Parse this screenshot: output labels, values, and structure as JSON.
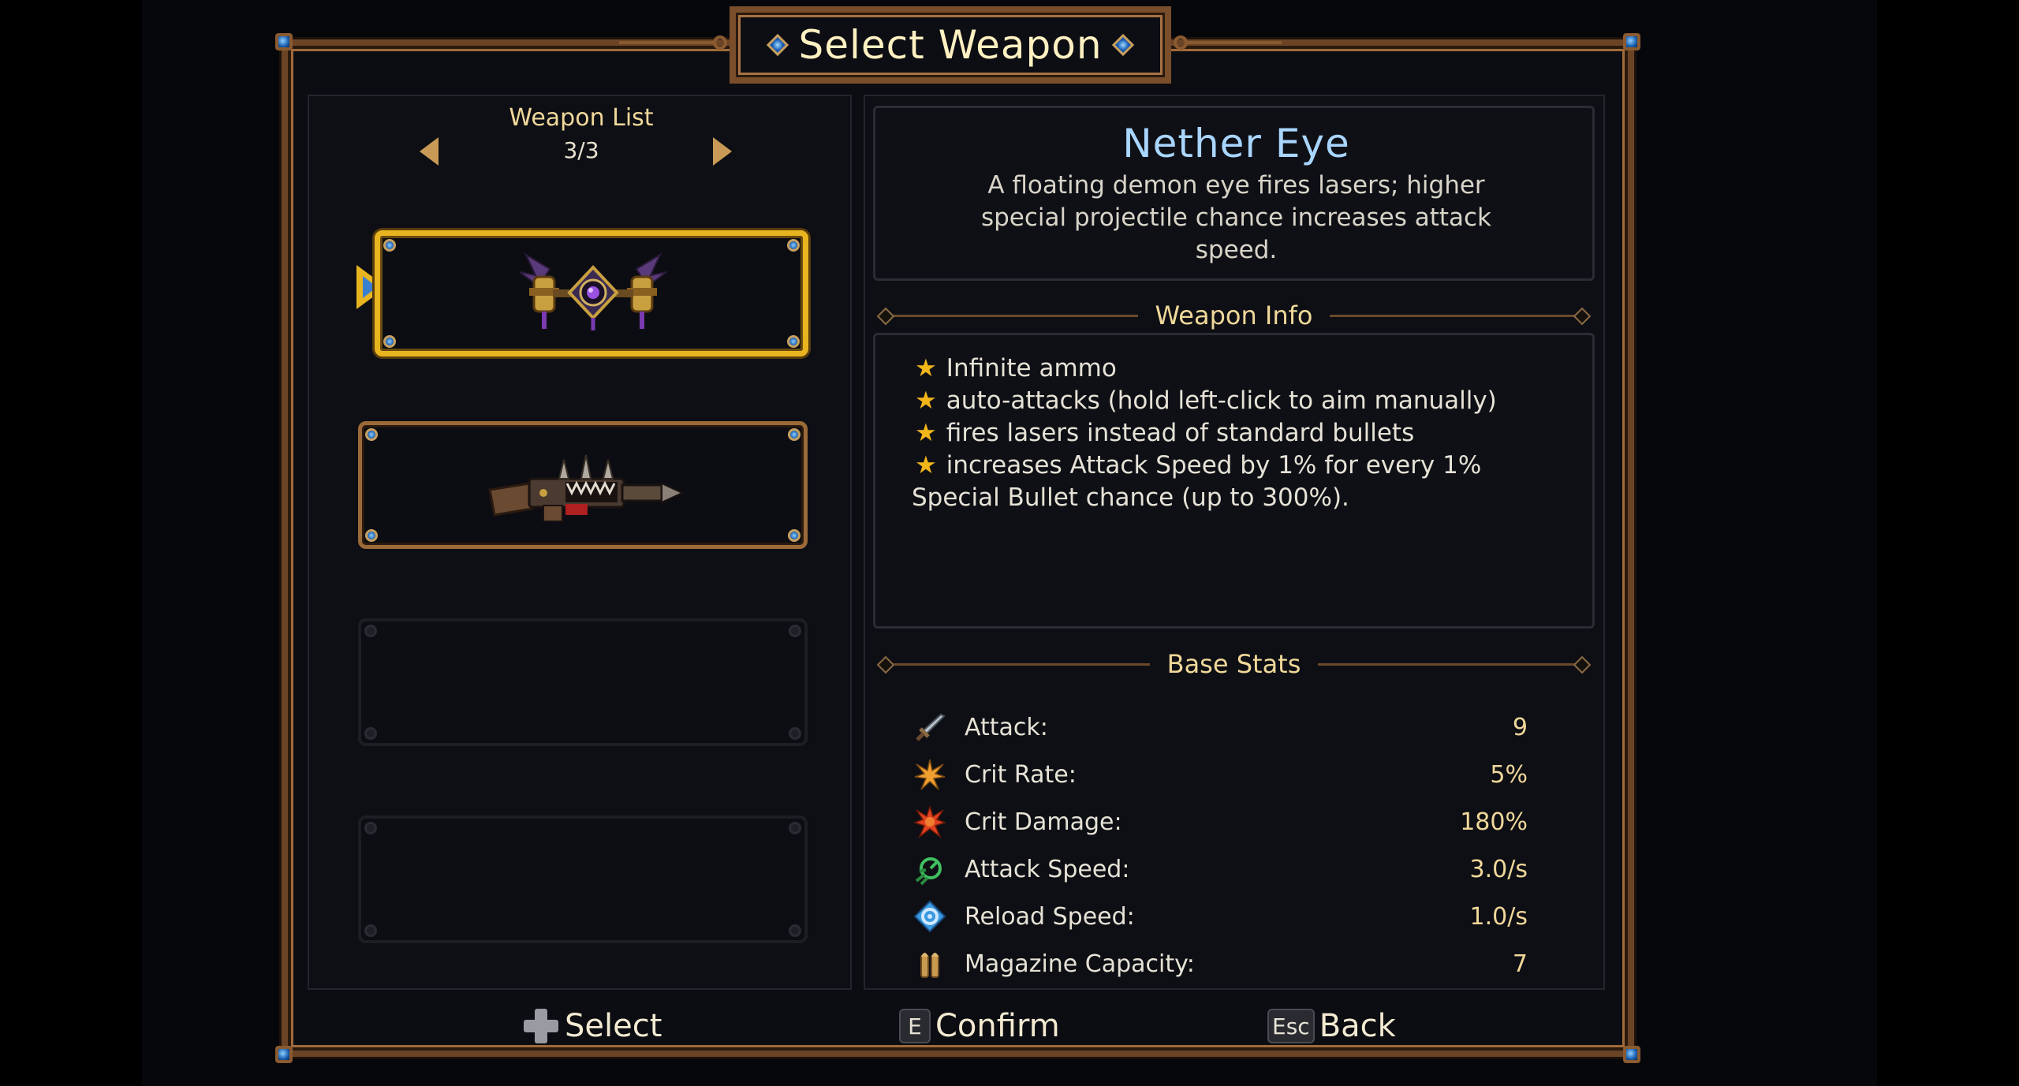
{
  "title": "Select Weapon",
  "weapon_list": {
    "title": "Weapon List",
    "page": "3/3",
    "slots": [
      {
        "state": "selected",
        "weapon_icon": "nether-eye-icon"
      },
      {
        "state": "normal",
        "weapon_icon": "spiked-gun-icon"
      },
      {
        "state": "empty"
      },
      {
        "state": "empty"
      }
    ]
  },
  "weapon": {
    "name": "Nether Eye",
    "description": "A floating demon eye fires lasers; higher special projectile chance increases attack speed."
  },
  "weapon_info": {
    "title": "Weapon Info",
    "items": [
      "Infinite ammo",
      "auto-attacks (hold left-click to aim manually)",
      "fires lasers instead of standard bullets",
      "increases Attack Speed by 1% for every 1%"
    ],
    "continuation": "Special Bullet chance (up to 300%)."
  },
  "base_stats": {
    "title": "Base Stats",
    "stats": [
      {
        "label": "Attack:",
        "value": "9",
        "icon": "sword-icon",
        "color": "#b8c2cc"
      },
      {
        "label": "Crit Rate:",
        "value": "5%",
        "icon": "crit-rate-icon",
        "color": "#f0a030"
      },
      {
        "label": "Crit Damage:",
        "value": "180%",
        "icon": "crit-damage-icon",
        "color": "#e04020"
      },
      {
        "label": "Attack Speed:",
        "value": "3.0/s",
        "icon": "attack-speed-icon",
        "color": "#40c060"
      },
      {
        "label": "Reload Speed:",
        "value": "1.0/s",
        "icon": "reload-speed-icon",
        "color": "#3a9ae0"
      },
      {
        "label": "Magazine Capacity:",
        "value": "7",
        "icon": "magazine-icon",
        "color": "#c89a50"
      }
    ]
  },
  "controls": {
    "select": {
      "label": "Select",
      "key_icon": "dpad-icon"
    },
    "confirm": {
      "label": "Confirm",
      "key": "E"
    },
    "back": {
      "label": "Back",
      "key": "Esc"
    }
  },
  "colors": {
    "accent_gold": "#e8b520",
    "name_blue": "#a9d6ff",
    "frame_bronze": "#7a4e2b"
  }
}
